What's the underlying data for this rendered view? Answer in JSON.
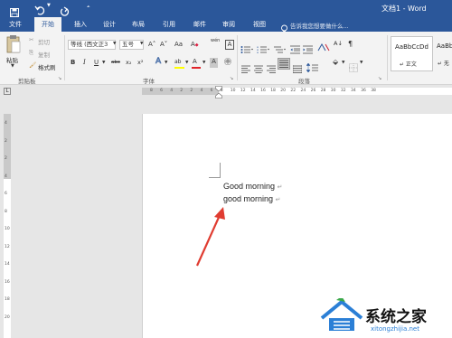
{
  "titlebar": {
    "title": "文档1 - Word",
    "save_icon": "save-icon",
    "undo_icon": "undo-icon",
    "redo_icon": "redo-icon",
    "customize_icon": "customize-toolbar-icon"
  },
  "tabs": [
    {
      "label": "文件"
    },
    {
      "label": "开始"
    },
    {
      "label": "插入"
    },
    {
      "label": "设计"
    },
    {
      "label": "布局"
    },
    {
      "label": "引用"
    },
    {
      "label": "邮件"
    },
    {
      "label": "审阅"
    },
    {
      "label": "视图"
    }
  ],
  "tell_me": {
    "placeholder": "告诉我您想要做什么..."
  },
  "ribbon": {
    "clipboard": {
      "paste_label": "粘贴",
      "cut_label": "剪切",
      "copy_label": "复制",
      "format_painter_label": "格式刷",
      "group_label": "剪贴板"
    },
    "font": {
      "font_name": "等线 (西文正3",
      "font_size": "五号",
      "grow_label": "A˄",
      "shrink_label": "A˅",
      "case_label": "Aa",
      "clear_label": "A",
      "wen_label": "wén",
      "border_char_label": "A",
      "bold": "B",
      "italic": "I",
      "underline": "U",
      "strike": "abc",
      "subscript": "x₂",
      "superscript": "x²",
      "text_effect": "A",
      "highlight": "ab",
      "font_color": "A",
      "shade": "A",
      "circle_char": "㊥",
      "group_label": "字体"
    },
    "paragraph": {
      "group_label": "段落"
    },
    "styles": {
      "preview_1": "AaBbCcDd",
      "name_1": "↵ 正文",
      "preview_2": "AaBb",
      "name_2": "↵ 无"
    }
  },
  "document": {
    "line1": "Good morning",
    "line2": "good morning",
    "para_mark": "↵"
  },
  "colors": {
    "accent": "#2b579a",
    "annotation_arrow": "#e03c31",
    "highlight_yellow": "#ffff00",
    "font_red": "#e0242a"
  },
  "watermark": {
    "brand": "系统之家",
    "url": "xitongzhijia.net"
  },
  "ruler": {
    "h_ticks": [
      "8",
      "6",
      "4",
      "2",
      "2",
      "4",
      "6",
      "8",
      "10",
      "12",
      "14",
      "16",
      "18",
      "20",
      "22",
      "24",
      "26",
      "28",
      "30",
      "32",
      "34",
      "36",
      "38"
    ],
    "v_ticks": [
      "4",
      "2",
      "2",
      "4",
      "6",
      "8",
      "10",
      "12",
      "14",
      "16",
      "18",
      "20"
    ]
  }
}
